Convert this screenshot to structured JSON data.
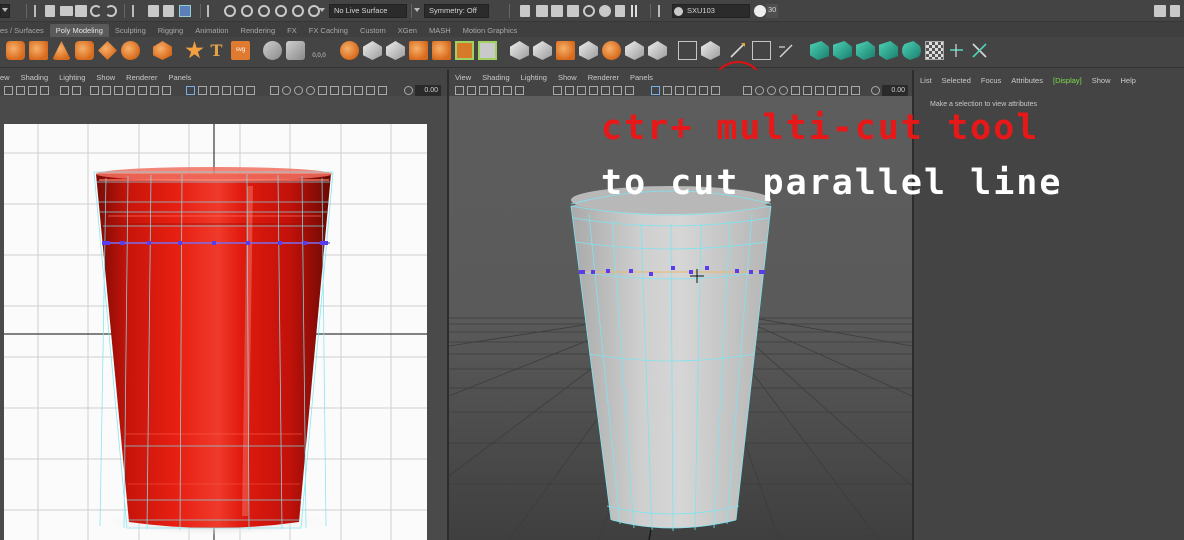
{
  "status_line": {
    "mode_menu_value": "",
    "live_surface": "No Live Surface",
    "symmetry": "Symmetry: Off",
    "workspace_user": "SXU103",
    "time_value": "30"
  },
  "shelf_tabs": [
    {
      "label": "es / Surfaces",
      "active": false
    },
    {
      "label": "Poly Modeling",
      "active": true
    },
    {
      "label": "Sculpting",
      "active": false
    },
    {
      "label": "Rigging",
      "active": false
    },
    {
      "label": "Animation",
      "active": false
    },
    {
      "label": "Rendering",
      "active": false
    },
    {
      "label": "FX",
      "active": false
    },
    {
      "label": "FX Caching",
      "active": false
    },
    {
      "label": "Custom",
      "active": false
    },
    {
      "label": "XGen",
      "active": false
    },
    {
      "label": "MASH",
      "active": false
    },
    {
      "label": "Motion Graphics",
      "active": false
    }
  ],
  "shelf_icons": {
    "text_tool_glyph": "T",
    "svg_tool_label": "svg",
    "coord_readout": "0,0,0"
  },
  "viewport_left": {
    "menu": [
      "ew",
      "Shading",
      "Lighting",
      "Show",
      "Renderer",
      "Panels"
    ],
    "field_value": "0.00"
  },
  "viewport_right": {
    "menu": [
      "View",
      "Shading",
      "Lighting",
      "Show",
      "Renderer",
      "Panels"
    ],
    "field_value": "0.00"
  },
  "attribute_editor": {
    "menu": [
      "List",
      "Selected",
      "Focus",
      "Attributes",
      "[Display]",
      "Show",
      "Help"
    ],
    "hint": "Make a selection to view attributes"
  },
  "overlay_caption": {
    "line1": "ctr+ multi-cut tool",
    "line2": "to cut parallel line"
  },
  "colors": {
    "ui_background": "#444444",
    "caption_red": "#e81818",
    "highlight_circle": "#e01010",
    "cup_red": "#d8190e",
    "wire_cyan": "#7fe4f0",
    "edge_selection_purple": "#5a3cf0",
    "display_green": "#7dde4a"
  }
}
